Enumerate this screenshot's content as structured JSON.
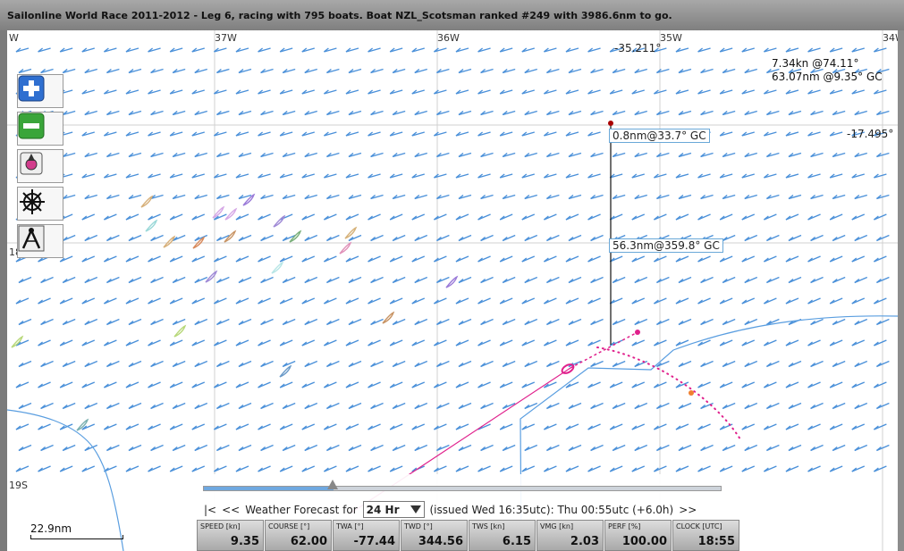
{
  "window": {
    "title": "Sailonline World Race 2011-2012 - Leg 6, racing with 795 boats. Boat NZL_Scotsman ranked #249 with 3986.6nm to go."
  },
  "map": {
    "longitude_labels": [
      "W",
      "37W",
      "36W",
      "35W",
      "34W"
    ],
    "latitude_labels": [
      "18S",
      "19S"
    ],
    "cursor_lon": "-35.211°",
    "cursor_lat": "-17.495°",
    "info_line1": "7.34kn @74.11°",
    "info_line2": "63.07nm @9.35° GC",
    "measure_label_1": "0.8nm@33.7° GC",
    "measure_label_2": "56.3nm@359.8° GC",
    "scale_label": "22.9nm",
    "wind_color": "#4a90d9",
    "track_color": "#e0208c",
    "coast_color": "#5a9ee0"
  },
  "tools": [
    {
      "name": "zoom-in-icon"
    },
    {
      "name": "zoom-out-icon"
    },
    {
      "name": "center-boat-icon"
    },
    {
      "name": "steering-wheel-icon"
    },
    {
      "name": "compass-divider-icon"
    }
  ],
  "weather": {
    "first_btn": "|<",
    "prev_btn": "<<",
    "label": "Weather Forecast for",
    "select_value": "24 Hr",
    "issued_text": "(issued Wed 16:35utc): Thu 00:55utc  (+6.0h)",
    "next_btn": ">>",
    "slider_position": 0.25
  },
  "stats": [
    {
      "header": "SPEED [kn]",
      "value": "9.35"
    },
    {
      "header": "COURSE [°]",
      "value": "62.00"
    },
    {
      "header": "TWA [°]",
      "value": "-77.44"
    },
    {
      "header": "TWD [°]",
      "value": "344.56"
    },
    {
      "header": "TWS [kn]",
      "value": "6.15"
    },
    {
      "header": "VMG [kn]",
      "value": "2.03"
    },
    {
      "header": "PERF [%]",
      "value": "100.00"
    },
    {
      "header": "CLOCK [UTC]",
      "value": "18:55"
    }
  ]
}
